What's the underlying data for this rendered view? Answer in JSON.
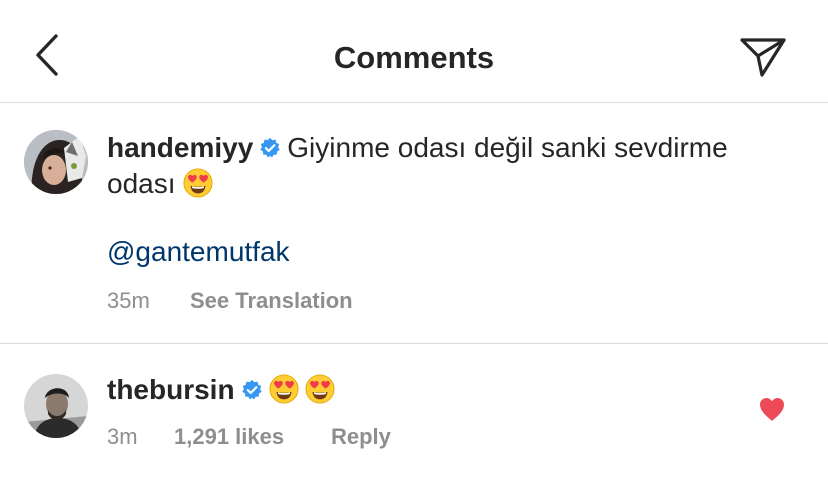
{
  "header": {
    "title": "Comments",
    "back_icon": "chevron-left-icon",
    "send_icon": "paper-plane-icon"
  },
  "comment": {
    "username": "handemiyy",
    "verified": true,
    "text": "Giyinme odası değil sanki sevdirme odası",
    "emoji": "heart-eyes-emoji",
    "mention": "@gantemutfak",
    "time": "35m",
    "translate_label": "See Translation"
  },
  "reply": {
    "username": "thebursin",
    "verified": true,
    "emojis": [
      "heart-eyes-emoji",
      "heart-eyes-emoji"
    ],
    "time": "3m",
    "likes": "1,291 likes",
    "reply_label": "Reply",
    "liked": true
  },
  "colors": {
    "text": "#262626",
    "secondary": "#8e8e8e",
    "link": "#00376b",
    "verified": "#3897f0",
    "heart": "#ed4956",
    "divider": "#dbdbdb"
  }
}
